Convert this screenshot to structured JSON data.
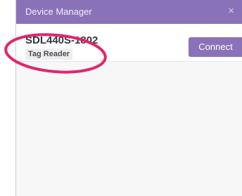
{
  "window": {
    "title": "Device Manager",
    "close_glyph": "×",
    "close_icon": "close-icon"
  },
  "device": {
    "name": "SDL440S-1802",
    "tag": "Tag Reader",
    "connect_label": "Connect"
  },
  "colors": {
    "accent": "#8a72b8",
    "annotation": "#e5236b"
  }
}
